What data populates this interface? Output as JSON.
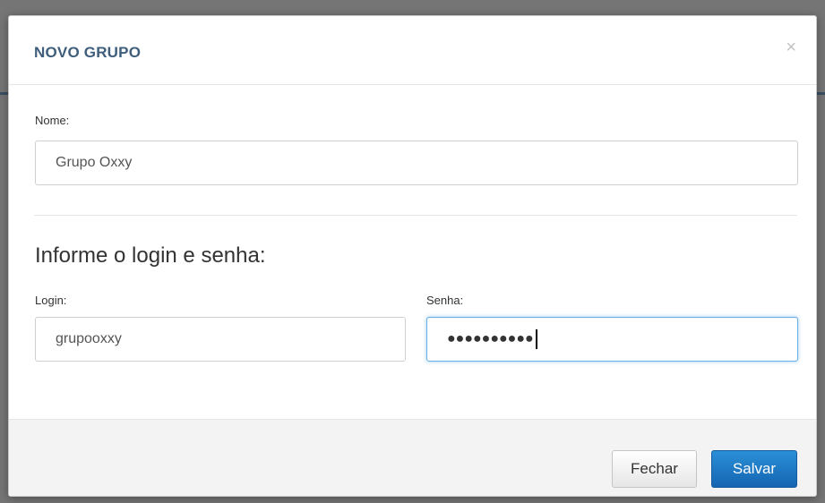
{
  "dialog": {
    "title": "NOVO GRUPO",
    "close_glyph": "×"
  },
  "form": {
    "nome": {
      "label": "Nome:",
      "value": "Grupo Oxxy"
    },
    "credentials_heading": "Informe o login e senha:",
    "login": {
      "label": "Login:",
      "value": "grupooxxy"
    },
    "senha": {
      "label": "Senha:",
      "masked_value": "●●●●●●●●●●"
    }
  },
  "footer": {
    "close_label": "Fechar",
    "save_label": "Salvar"
  },
  "colors": {
    "title": "#3f5e7c",
    "primary": "#1a75c4",
    "focus_border": "#66afe9"
  },
  "icons": {
    "close": "close-icon"
  }
}
